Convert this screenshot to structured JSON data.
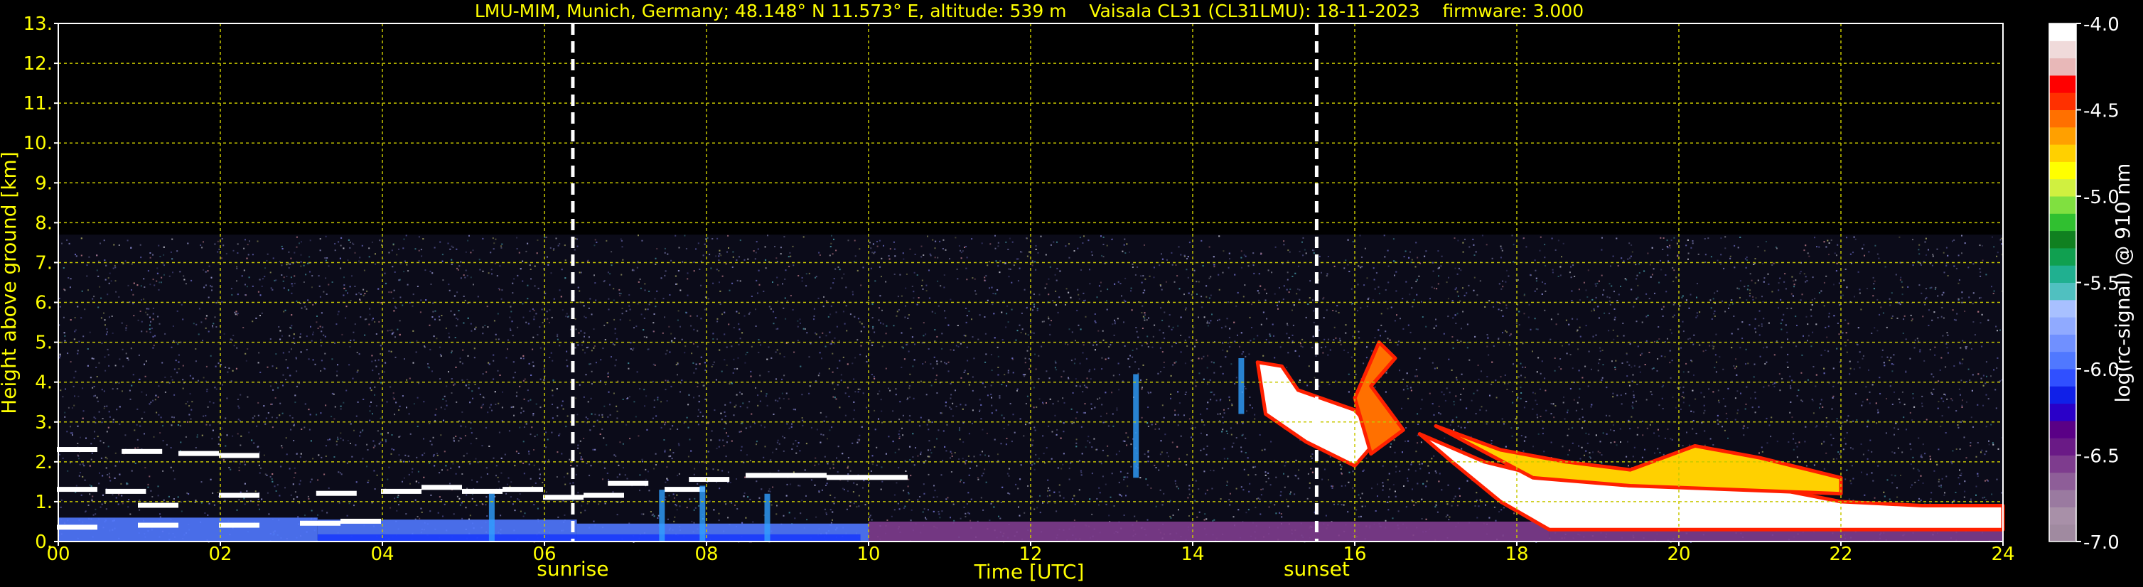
{
  "chart_data": {
    "type": "heatmap",
    "title": "LMU-MIM, Munich, Germany; 48.148° N 11.573° E, altitude: 539 m    Vaisala CL31 (CL31LMU): 18-11-2023    firmware: 3.000",
    "xlabel": "Time [UTC]",
    "ylabel": "Height above ground [km]",
    "xlim": [
      0,
      24
    ],
    "ylim": [
      0,
      13
    ],
    "x_ticks": [
      {
        "value": 0,
        "label": "00"
      },
      {
        "value": 2,
        "label": "02"
      },
      {
        "value": 4,
        "label": "04"
      },
      {
        "value": 6,
        "label": "06"
      },
      {
        "value": 8,
        "label": "08"
      },
      {
        "value": 10,
        "label": "10"
      },
      {
        "value": 12,
        "label": "12"
      },
      {
        "value": 14,
        "label": "14"
      },
      {
        "value": 16,
        "label": "16"
      },
      {
        "value": 18,
        "label": "18"
      },
      {
        "value": 20,
        "label": "20"
      },
      {
        "value": 22,
        "label": "22"
      },
      {
        "value": 24,
        "label": "24"
      }
    ],
    "y_ticks": [
      {
        "value": 0,
        "label": "0."
      },
      {
        "value": 1,
        "label": "1."
      },
      {
        "value": 2,
        "label": "2."
      },
      {
        "value": 3,
        "label": "3."
      },
      {
        "value": 4,
        "label": "4."
      },
      {
        "value": 5,
        "label": "5."
      },
      {
        "value": 6,
        "label": "6."
      },
      {
        "value": 7,
        "label": "7."
      },
      {
        "value": 8,
        "label": "8."
      },
      {
        "value": 9,
        "label": "9."
      },
      {
        "value": 10,
        "label": "10."
      },
      {
        "value": 11,
        "label": "11."
      },
      {
        "value": 12,
        "label": "12."
      },
      {
        "value": 13,
        "label": "13."
      }
    ],
    "grid": true,
    "grid_color": "#c8c800",
    "markers": [
      {
        "label": "sunrise",
        "x": 6.35
      },
      {
        "label": "sunset",
        "x": 15.53
      }
    ],
    "signal_top_km": 7.7,
    "colorbar": {
      "label": "log(rc-signal) @ 910 nm",
      "min": -7.0,
      "max": -4.0,
      "ticks": [
        {
          "value": -4.0,
          "label": "-4.0"
        },
        {
          "value": -4.5,
          "label": "-4.5"
        },
        {
          "value": -5.0,
          "label": "-5.0"
        },
        {
          "value": -5.5,
          "label": "-5.5"
        },
        {
          "value": -6.0,
          "label": "-6.0"
        },
        {
          "value": -6.5,
          "label": "-6.5"
        },
        {
          "value": -7.0,
          "label": "-7.0"
        }
      ],
      "colors": [
        "#a08aa0",
        "#a890a8",
        "#9a7aa0",
        "#8e5e98",
        "#7e3c8e",
        "#6a1a86",
        "#5a0086",
        "#2a00c8",
        "#1020e8",
        "#3050ff",
        "#5078ff",
        "#7090ff",
        "#90aaff",
        "#a8c0ff",
        "#50c0c0",
        "#20b090",
        "#10a050",
        "#108020",
        "#30c030",
        "#80e040",
        "#d0f040",
        "#ffff00",
        "#ffd000",
        "#ffa000",
        "#ff7000",
        "#ff3000",
        "#ff0000",
        "#e8b8b8",
        "#f0dada",
        "#ffffff"
      ]
    },
    "series": [
      {
        "name": "",
        "layer": "surface",
        "segments": [
          {
            "x0": 0,
            "x1": 3.2,
            "y0": 0,
            "y1": 0.6,
            "level": -5.9
          },
          {
            "x0": 3.2,
            "x1": 6.4,
            "y0": 0,
            "y1": 0.55,
            "level": -5.95
          },
          {
            "x0": 6.4,
            "x1": 10,
            "y0": 0,
            "y1": 0.45,
            "level": -6.0
          },
          {
            "x0": 10,
            "x1": 18.4,
            "y0": 0,
            "y1": 0.5,
            "level": -6.55
          },
          {
            "x0": 18.4,
            "x1": 24,
            "y0": 0,
            "y1": 0.3,
            "level": -6.6
          }
        ]
      },
      {
        "name": "",
        "layer": "cloud-base",
        "points": [
          [
            0,
            2.3
          ],
          [
            0.8,
            2.25
          ],
          [
            1.5,
            2.2
          ],
          [
            2.0,
            2.15
          ],
          [
            0,
            1.3
          ],
          [
            0.6,
            1.25
          ],
          [
            1.0,
            0.9
          ],
          [
            0,
            0.35
          ],
          [
            1.0,
            0.4
          ],
          [
            2.0,
            0.4
          ],
          [
            3.0,
            0.45
          ],
          [
            3.5,
            0.5
          ],
          [
            2.0,
            1.15
          ],
          [
            3.2,
            1.2
          ],
          [
            4.0,
            1.25
          ],
          [
            4.5,
            1.35
          ],
          [
            5.0,
            1.25
          ],
          [
            5.5,
            1.3
          ],
          [
            6.0,
            1.1
          ],
          [
            6.5,
            1.15
          ],
          [
            6.8,
            1.45
          ],
          [
            7.5,
            1.3
          ],
          [
            7.8,
            1.55
          ],
          [
            8.5,
            1.65
          ],
          [
            9.0,
            1.65
          ],
          [
            9.5,
            1.6
          ],
          [
            10.0,
            1.6
          ]
        ]
      },
      {
        "name": "",
        "layer": "evening-cloud",
        "shapes": [
          {
            "points": [
              [
                14.8,
                4.5
              ],
              [
                15.1,
                4.4
              ],
              [
                15.3,
                3.8
              ],
              [
                16.0,
                3.3
              ],
              [
                16.3,
                2.6
              ],
              [
                16.0,
                1.9
              ],
              [
                15.4,
                2.5
              ],
              [
                14.9,
                3.2
              ]
            ],
            "level": -4.1
          },
          {
            "points": [
              [
                16.3,
                5.0
              ],
              [
                16.5,
                4.6
              ],
              [
                16.2,
                3.9
              ],
              [
                16.6,
                2.8
              ],
              [
                16.2,
                2.2
              ],
              [
                16.0,
                3.6
              ]
            ],
            "level": -4.6
          },
          {
            "points": [
              [
                16.8,
                2.7
              ],
              [
                17.6,
                2.0
              ],
              [
                18.4,
                1.6
              ],
              [
                19.4,
                1.4
              ],
              [
                20.3,
                1.6
              ],
              [
                21.0,
                1.4
              ],
              [
                22.0,
                1.0
              ],
              [
                23.0,
                0.9
              ],
              [
                24.0,
                0.9
              ],
              [
                24.0,
                0.3
              ],
              [
                18.4,
                0.3
              ],
              [
                17.8,
                1.0
              ],
              [
                17.2,
                2.0
              ]
            ],
            "level": -4.05
          },
          {
            "points": [
              [
                17.0,
                2.9
              ],
              [
                17.8,
                2.3
              ],
              [
                18.6,
                2.0
              ],
              [
                19.4,
                1.8
              ],
              [
                20.2,
                2.4
              ],
              [
                21.0,
                2.1
              ],
              [
                22.0,
                1.6
              ],
              [
                22.0,
                1.2
              ],
              [
                19.4,
                1.4
              ],
              [
                18.2,
                1.6
              ]
            ],
            "level": -4.8
          }
        ]
      },
      {
        "name": "",
        "layer": "precip-streaks",
        "segments": [
          {
            "x": 5.35,
            "y0": 0.0,
            "y1": 1.2
          },
          {
            "x": 7.45,
            "y0": 0.0,
            "y1": 1.3
          },
          {
            "x": 7.95,
            "y0": 0.0,
            "y1": 1.4
          },
          {
            "x": 8.75,
            "y0": 0.0,
            "y1": 1.2
          },
          {
            "x": 13.3,
            "y0": 1.6,
            "y1": 4.2
          },
          {
            "x": 14.6,
            "y0": 3.2,
            "y1": 4.6
          }
        ]
      }
    ]
  }
}
